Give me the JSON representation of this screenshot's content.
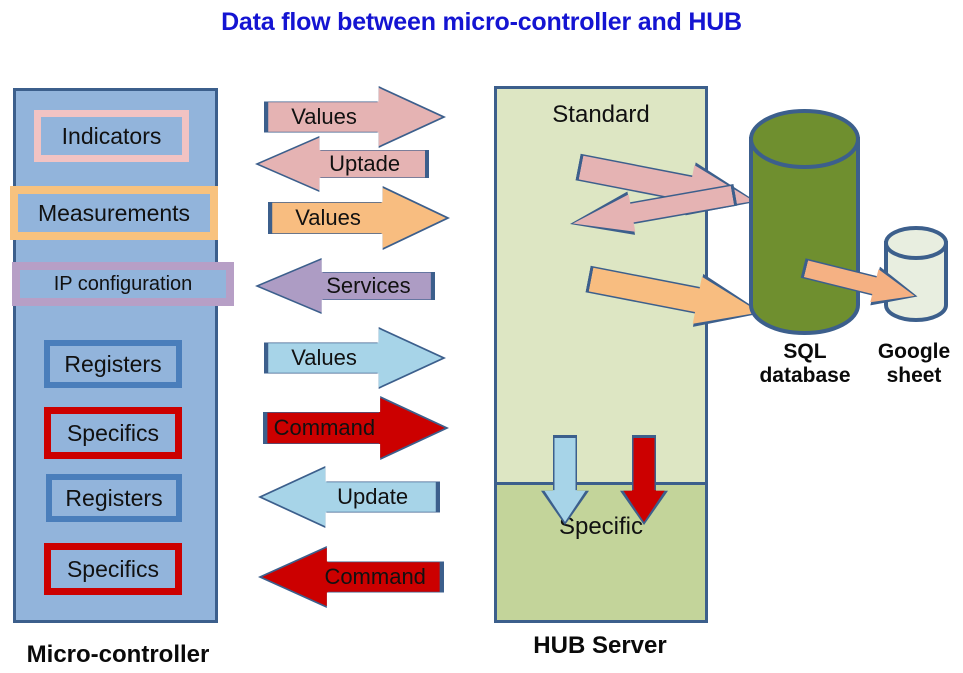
{
  "title": "Data flow between micro-controller and HUB",
  "colors": {
    "title": "#1414d2",
    "outline": "#3c5f8c",
    "panel_blue": "#92b4db",
    "pink": "#e5b3b3",
    "orange": "#f8bd80",
    "purple": "#ad9cc4",
    "lightblue": "#a7d4e8",
    "red": "#cc0000",
    "hub_standard": "#dde6c3",
    "hub_specific": "#c3d49a",
    "sql_green": "#6f8f2f",
    "sheet_pale": "#e8eee0",
    "box_pink_border": "#f2c3c3",
    "box_orange_border": "#f8c27e",
    "box_purple_border": "#b79fc6",
    "box_blue_border": "#4a7ebb",
    "box_red_border": "#cc0000"
  },
  "microcontroller": {
    "label": "Micro-controller",
    "boxes": [
      {
        "label": "Indicators",
        "border": "#f2c3c3"
      },
      {
        "label": "Measurements",
        "border": "#f8c27e"
      },
      {
        "label": "IP configuration",
        "border": "#b79fc6"
      },
      {
        "label": "Registers",
        "border": "#4a7ebb"
      },
      {
        "label": "Specifics",
        "border": "#cc0000"
      },
      {
        "label": "Registers",
        "border": "#4a7ebb"
      },
      {
        "label": "Specifics",
        "border": "#cc0000"
      }
    ]
  },
  "flow_arrows": [
    {
      "label": "Values",
      "direction": "right",
      "fill": "#e5b3b3"
    },
    {
      "label": "Uptade",
      "direction": "left",
      "fill": "#e5b3b3"
    },
    {
      "label": "Values",
      "direction": "right",
      "fill": "#f8bd80"
    },
    {
      "label": "Services",
      "direction": "left",
      "fill": "#ad9cc4"
    },
    {
      "label": "Values",
      "direction": "right",
      "fill": "#a7d4e8"
    },
    {
      "label": "Command",
      "direction": "right",
      "fill": "#cc0000"
    },
    {
      "label": "Update",
      "direction": "left",
      "fill": "#a7d4e8"
    },
    {
      "label": "Command",
      "direction": "left",
      "fill": "#cc0000"
    }
  ],
  "hub": {
    "label": "HUB Server",
    "zones": [
      {
        "label": "Standard",
        "fill": "#dde6c3"
      },
      {
        "label": "Specific",
        "fill": "#c3d49a"
      }
    ],
    "internal_arrows": [
      {
        "direction": "down",
        "fill": "#a7d4e8"
      },
      {
        "direction": "down",
        "fill": "#cc0000"
      }
    ],
    "db_arrows": [
      {
        "direction": "right",
        "fill": "#e5b3b3"
      },
      {
        "direction": "left",
        "fill": "#e5b3b3"
      },
      {
        "direction": "right",
        "fill": "#f8bd80"
      }
    ]
  },
  "databases": [
    {
      "label_line1": "SQL",
      "label_line2": "database",
      "fill": "#6f8f2f"
    },
    {
      "label_line1": "Google",
      "label_line2": "sheet",
      "fill": "#e8eee0"
    }
  ],
  "sheet_arrow": {
    "direction": "right",
    "fill": "#f5b183"
  }
}
